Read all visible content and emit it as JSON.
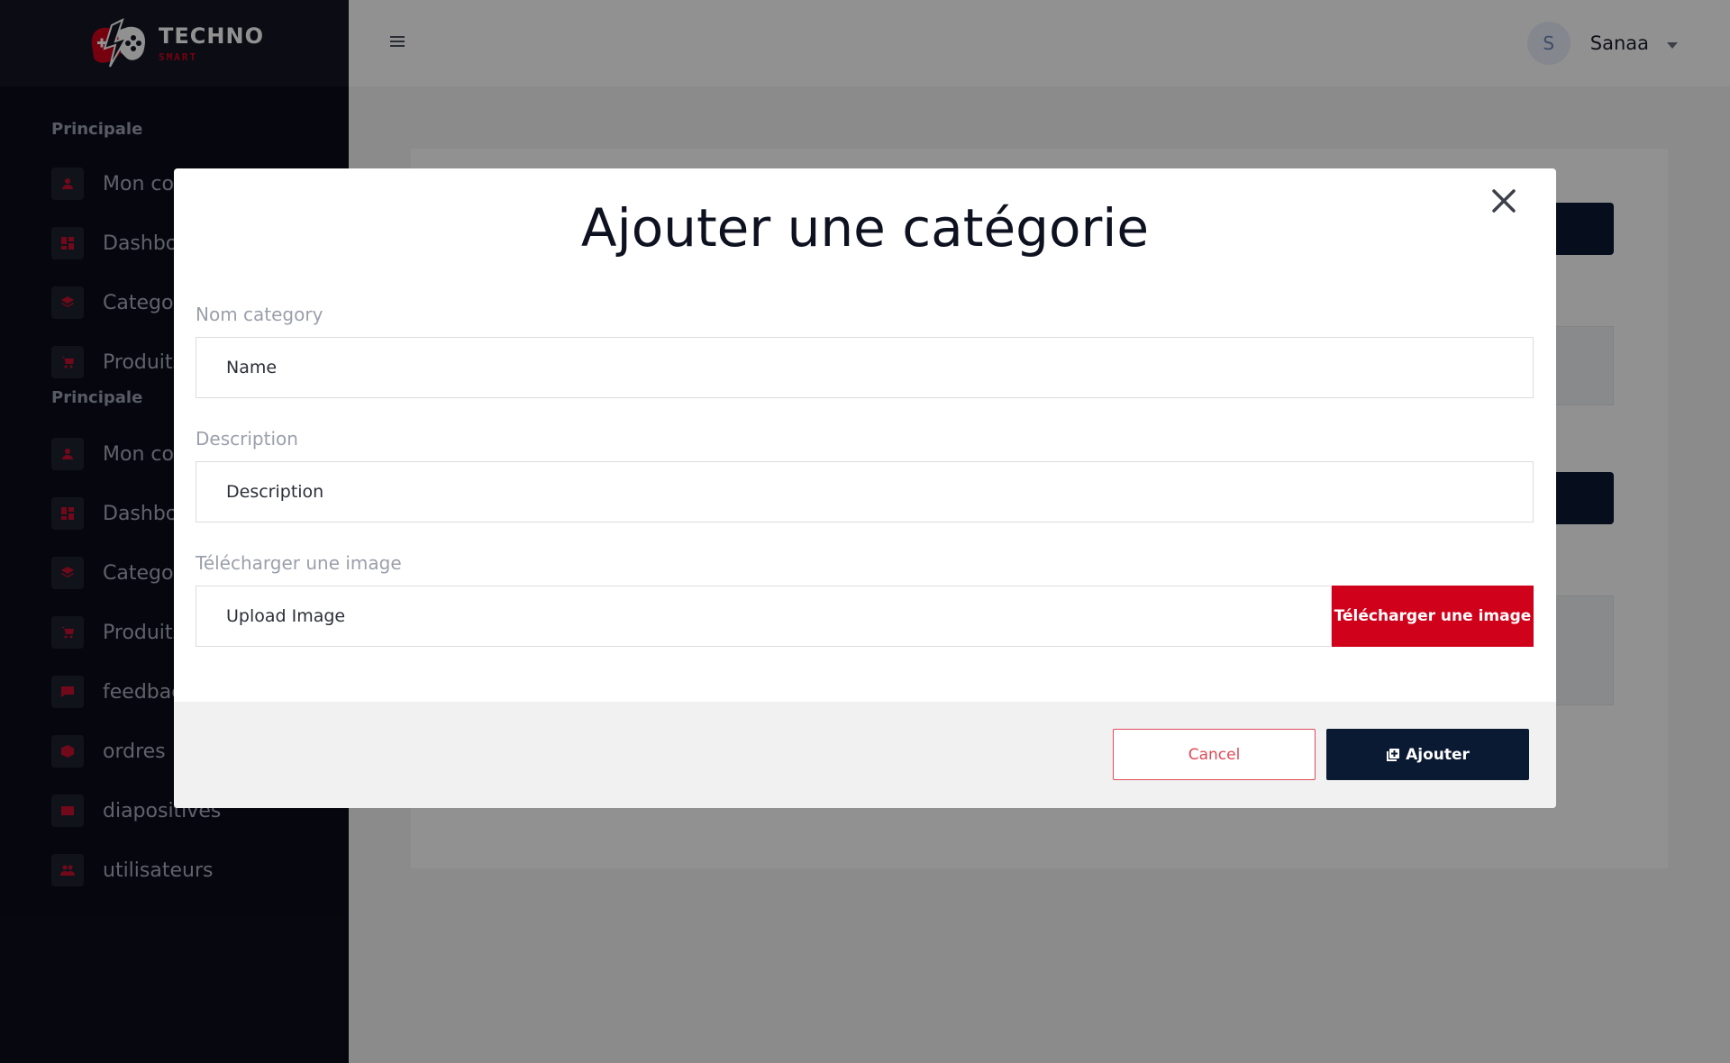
{
  "brand": {
    "title": "TECHNO",
    "subtitle": "SMART"
  },
  "sidebar": {
    "section_label_1": "Principale",
    "section_label_2": "Principale",
    "group1": [
      {
        "label": "Mon compte",
        "icon": "person-icon"
      },
      {
        "label": "Dashboard",
        "icon": "dashboard-icon"
      },
      {
        "label": "Categories",
        "icon": "layers-icon"
      },
      {
        "label": "Produits",
        "icon": "cart-icon"
      }
    ],
    "group2": [
      {
        "label": "Mon compte",
        "icon": "person-icon"
      },
      {
        "label": "Dashboard",
        "icon": "dashboard-icon"
      },
      {
        "label": "Categories",
        "icon": "layers-icon"
      },
      {
        "label": "Produits",
        "icon": "cart-icon"
      },
      {
        "label": "feedback",
        "icon": "chat-icon"
      },
      {
        "label": "ordres",
        "icon": "box-icon"
      },
      {
        "label": "diapositives",
        "icon": "slides-icon"
      },
      {
        "label": "utilisateurs",
        "icon": "users-icon"
      }
    ]
  },
  "header": {
    "avatar_initial": "S",
    "user_name": "Sanaa"
  },
  "modal": {
    "title": "Ajouter une catégorie",
    "name_label": "Nom category",
    "name_placeholder": "Name",
    "description_label": "Description",
    "description_placeholder": "Description",
    "image_label": "Télécharger une image",
    "image_placeholder": "Upload Image",
    "upload_button": "Télécharger une image",
    "cancel_button": "Cancel",
    "add_button": "Ajouter"
  },
  "colors": {
    "accent": "#d0021b",
    "navy": "#0b1a33",
    "sidebar": "#0c0e1a"
  }
}
